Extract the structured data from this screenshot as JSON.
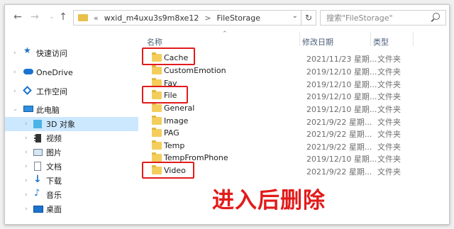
{
  "address": {
    "back_icon": "arrow-left-icon",
    "forward_icon": "arrow-right-icon",
    "up_icon": "arrow-up-icon",
    "overflow": "«",
    "crumbs": [
      "wxid_m4uxu3s9m8xe12",
      "FileStorage"
    ],
    "separator": ">",
    "refresh": "↻"
  },
  "search": {
    "placeholder": "搜索\"FileStorage\""
  },
  "sidebar": {
    "items": [
      {
        "label": "快速访问",
        "icon": "star-icon"
      },
      {
        "label": "OneDrive",
        "icon": "cloud-icon"
      },
      {
        "label": "工作空间",
        "icon": "workspace-icon"
      },
      {
        "label": "此电脑",
        "icon": "computer-icon"
      },
      {
        "label": "3D 对象",
        "icon": "cube-icon"
      },
      {
        "label": "视频",
        "icon": "video-icon"
      },
      {
        "label": "图片",
        "icon": "picture-icon"
      },
      {
        "label": "文档",
        "icon": "document-icon"
      },
      {
        "label": "下载",
        "icon": "download-icon"
      },
      {
        "label": "音乐",
        "icon": "music-icon"
      },
      {
        "label": "桌面",
        "icon": "desktop-icon"
      }
    ]
  },
  "columns": {
    "name": "名称",
    "date": "修改日期",
    "type": "类型"
  },
  "files": [
    {
      "name": "Cache",
      "date": "2021/11/23 星期...",
      "type": "文件夹"
    },
    {
      "name": "CustomEmotion",
      "date": "2019/12/10 星期...",
      "type": "文件夹"
    },
    {
      "name": "Fav",
      "date": "2019/12/10 星期...",
      "type": "文件夹"
    },
    {
      "name": "File",
      "date": "2019/12/10 星期...",
      "type": "文件夹"
    },
    {
      "name": "General",
      "date": "2019/12/10 星期...",
      "type": "文件夹"
    },
    {
      "name": "Image",
      "date": "2021/9/22 星期...",
      "type": "文件夹"
    },
    {
      "name": "PAG",
      "date": "2021/9/22 星期...",
      "type": "文件夹"
    },
    {
      "name": "Temp",
      "date": "2021/9/22 星期...",
      "type": "文件夹"
    },
    {
      "name": "TempFromPhone",
      "date": "2019/12/10 星期...",
      "type": "文件夹"
    },
    {
      "name": "Video",
      "date": "2021/9/22 星期...",
      "type": "文件夹"
    }
  ],
  "highlighted": [
    "Cache",
    "File",
    "Video"
  ],
  "annotation": "进入后删除",
  "colors": {
    "highlight": "#e21b1b",
    "folder": "#f4cd5c",
    "selection": "#cce8ff"
  }
}
